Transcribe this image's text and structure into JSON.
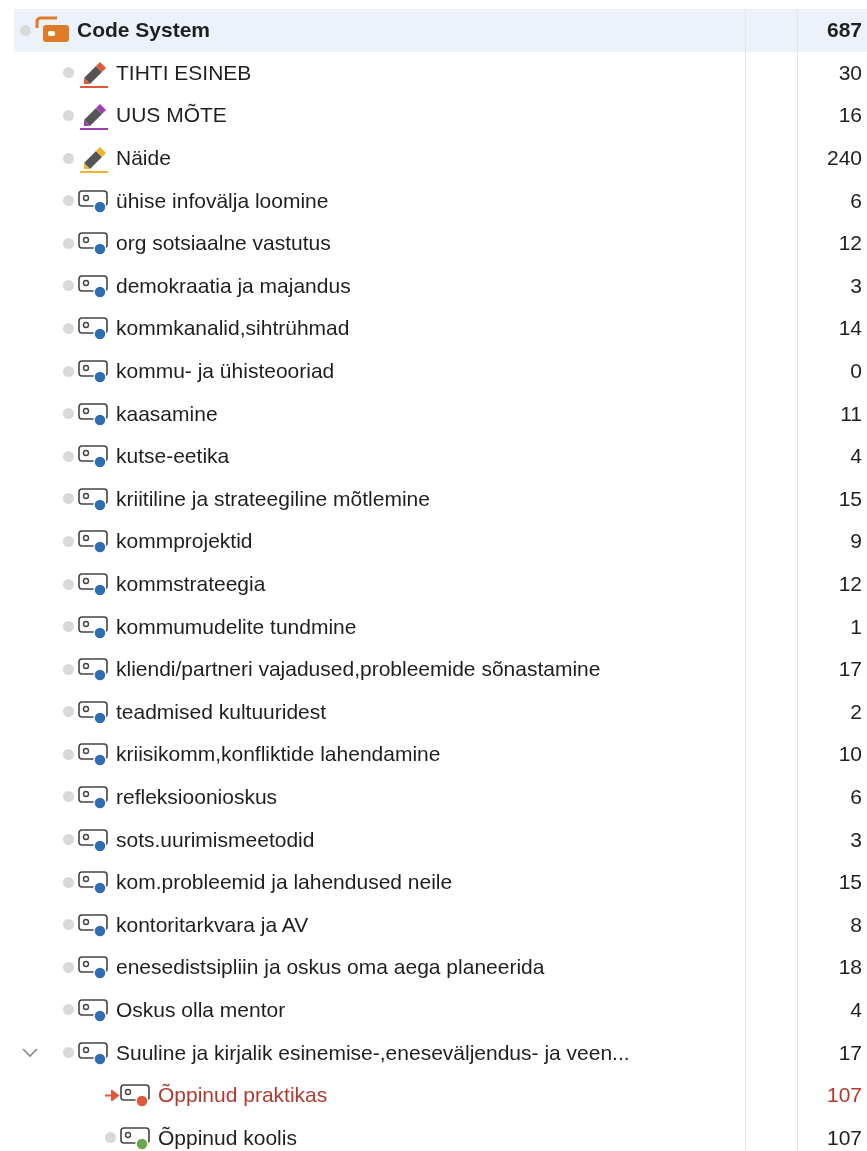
{
  "tree": [
    {
      "label": "Code System",
      "count": "687",
      "kind": "codesystem",
      "color": "#e07b2a",
      "selected": true,
      "active": false,
      "children": [
        {
          "label": "TIHTI ESINEB",
          "count": "30",
          "kind": "marker",
          "color": "#e0573a",
          "selected": false,
          "active": false
        },
        {
          "label": "UUS MÕTE",
          "count": "16",
          "kind": "marker",
          "color": "#9b3fb5",
          "selected": false,
          "active": false
        },
        {
          "label": "Näide",
          "count": "240",
          "kind": "marker",
          "color": "#f0b429",
          "selected": false,
          "active": false
        },
        {
          "label": "ühise infovälja loomine",
          "count": "6",
          "kind": "code",
          "color": "#2f6db5",
          "selected": false,
          "active": false
        },
        {
          "label": "org sotsiaalne vastutus",
          "count": "12",
          "kind": "code",
          "color": "#2f6db5",
          "selected": false,
          "active": false
        },
        {
          "label": "demokraatia ja majandus",
          "count": "3",
          "kind": "code",
          "color": "#2f6db5",
          "selected": false,
          "active": false
        },
        {
          "label": "kommkanalid,sihtrühmad",
          "count": "14",
          "kind": "code",
          "color": "#2f6db5",
          "selected": false,
          "active": false
        },
        {
          "label": "kommu- ja ühisteooriad",
          "count": "0",
          "kind": "code",
          "color": "#2f6db5",
          "selected": false,
          "active": false
        },
        {
          "label": "kaasamine",
          "count": "11",
          "kind": "code",
          "color": "#2f6db5",
          "selected": false,
          "active": false
        },
        {
          "label": "kutse-eetika",
          "count": "4",
          "kind": "code",
          "color": "#2f6db5",
          "selected": false,
          "active": false
        },
        {
          "label": "kriitiline ja strateegiline mõtlemine",
          "count": "15",
          "kind": "code",
          "color": "#2f6db5",
          "selected": false,
          "active": false
        },
        {
          "label": "kommprojektid",
          "count": "9",
          "kind": "code",
          "color": "#2f6db5",
          "selected": false,
          "active": false
        },
        {
          "label": "kommstrateegia",
          "count": "12",
          "kind": "code",
          "color": "#2f6db5",
          "selected": false,
          "active": false
        },
        {
          "label": "kommumudelite tundmine",
          "count": "1",
          "kind": "code",
          "color": "#2f6db5",
          "selected": false,
          "active": false
        },
        {
          "label": "kliendi/partneri vajadused,probleemide sõnastamine",
          "count": "17",
          "kind": "code",
          "color": "#2f6db5",
          "selected": false,
          "active": false
        },
        {
          "label": "teadmised kultuuridest",
          "count": "2",
          "kind": "code",
          "color": "#2f6db5",
          "selected": false,
          "active": false
        },
        {
          "label": "kriisikomm,konfliktide lahendamine",
          "count": "10",
          "kind": "code",
          "color": "#2f6db5",
          "selected": false,
          "active": false
        },
        {
          "label": "refleksioonioskus",
          "count": "6",
          "kind": "code",
          "color": "#2f6db5",
          "selected": false,
          "active": false
        },
        {
          "label": "sots.uurimismeetodid",
          "count": "3",
          "kind": "code",
          "color": "#2f6db5",
          "selected": false,
          "active": false
        },
        {
          "label": "kom.probleemid ja lahendused neile",
          "count": "15",
          "kind": "code",
          "color": "#2f6db5",
          "selected": false,
          "active": false
        },
        {
          "label": "kontoritarkvara ja AV",
          "count": "8",
          "kind": "code",
          "color": "#2f6db5",
          "selected": false,
          "active": false
        },
        {
          "label": "enesedistsipliin ja oskus oma aega planeerida",
          "count": "18",
          "kind": "code",
          "color": "#2f6db5",
          "selected": false,
          "active": false
        },
        {
          "label": "Oskus olla mentor",
          "count": "4",
          "kind": "code",
          "color": "#2f6db5",
          "selected": false,
          "active": false
        },
        {
          "label": "Suuline ja kirjalik esinemise-,eneseväljendus- ja veen...",
          "count": "17",
          "kind": "code",
          "color": "#2f6db5",
          "selected": false,
          "active": false,
          "expanded": true,
          "children": [
            {
              "label": "Õppinud praktikas",
              "count": "107",
              "kind": "code",
              "color": "#e0573a",
              "selected": false,
              "active": true
            },
            {
              "label": "Õppinud koolis",
              "count": "107",
              "kind": "code",
              "color": "#6aa84f",
              "selected": false,
              "active": false
            }
          ]
        }
      ]
    }
  ]
}
